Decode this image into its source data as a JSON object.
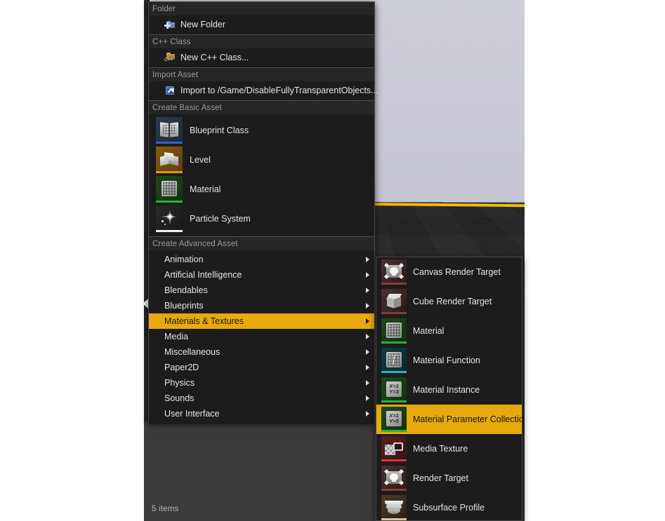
{
  "viewport": {
    "name": "level-viewport",
    "sky_color": "#c9cad5",
    "ground_color": "#2d2d2d",
    "horizon_color": "#f4b30a"
  },
  "content_browser": {
    "item_count_label": "5 items",
    "collapse_arrow_icon": "chevron-left-icon"
  },
  "context_menu": {
    "sections": [
      {
        "id": "folder",
        "header": "Folder",
        "type": "small",
        "items": [
          {
            "label": "New Folder",
            "icon": "new-folder-icon"
          }
        ]
      },
      {
        "id": "cpp-class",
        "header": "C++ Class",
        "type": "small",
        "items": [
          {
            "label": "New C++ Class...",
            "icon": "cpp-class-icon"
          }
        ]
      },
      {
        "id": "import-asset",
        "header": "Import Asset",
        "type": "small",
        "items": [
          {
            "label": "Import to /Game/DisableFullyTransparentObjects...",
            "icon": "import-icon"
          }
        ]
      },
      {
        "id": "create-basic-asset",
        "header": "Create Basic Asset",
        "type": "big",
        "items": [
          {
            "label": "Blueprint Class",
            "icon": "blueprint-class-icon",
            "stripe": "#2f62c4"
          },
          {
            "label": "Level",
            "icon": "level-icon",
            "stripe": "#e8950c"
          },
          {
            "label": "Material",
            "icon": "material-icon",
            "stripe": "#2fae38"
          },
          {
            "label": "Particle System",
            "icon": "particle-system-icon",
            "stripe": "#f2f2f2"
          }
        ]
      },
      {
        "id": "create-advanced-asset",
        "header": "Create Advanced Asset",
        "type": "submenu",
        "items": [
          {
            "label": "Animation",
            "selected": false
          },
          {
            "label": "Artificial Intelligence",
            "selected": false
          },
          {
            "label": "Blendables",
            "selected": false
          },
          {
            "label": "Blueprints",
            "selected": false
          },
          {
            "label": "Materials & Textures",
            "selected": true
          },
          {
            "label": "Media",
            "selected": false
          },
          {
            "label": "Miscellaneous",
            "selected": false
          },
          {
            "label": "Paper2D",
            "selected": false
          },
          {
            "label": "Physics",
            "selected": false
          },
          {
            "label": "Sounds",
            "selected": false
          },
          {
            "label": "User Interface",
            "selected": false
          }
        ]
      }
    ]
  },
  "submenu": {
    "parent": "Materials & Textures",
    "items": [
      {
        "label": "Canvas Render Target",
        "icon": "canvas-render-target-icon",
        "stripe": "#8c3a3a",
        "selected": false
      },
      {
        "label": "Cube Render Target",
        "icon": "cube-render-target-icon",
        "stripe": "#8c3a3a",
        "selected": false
      },
      {
        "label": "Material",
        "icon": "material-icon",
        "stripe": "#2fae38",
        "selected": false
      },
      {
        "label": "Material Function",
        "icon": "material-function-icon",
        "stripe": "#17b9c6",
        "selected": false
      },
      {
        "label": "Material Instance",
        "icon": "material-instance-icon",
        "stripe": "#2fae38",
        "selected": false
      },
      {
        "label": "Material Parameter Collection",
        "icon": "material-parameter-collection-icon",
        "stripe": "#2fae38",
        "selected": true
      },
      {
        "label": "Media Texture",
        "icon": "media-texture-icon",
        "stripe": "#e03030",
        "selected": false
      },
      {
        "label": "Render Target",
        "icon": "render-target-icon",
        "stripe": "#8c3a3a",
        "selected": false
      },
      {
        "label": "Subsurface Profile",
        "icon": "subsurface-profile-icon",
        "stripe": "#e8c08a",
        "selected": false
      }
    ]
  },
  "icon_text": {
    "cpp": "C++",
    "mf": "f",
    "mi_x": "X=1",
    "mi_y": "Y=3",
    "mpc_x": "X=1",
    "mpc_y": "Y=5"
  },
  "colors": {
    "highlight": "#e7a90c",
    "menu_bg": "#1c1c1c",
    "header_bg": "#262626",
    "text": "#e3e3e3",
    "header_text": "#9a9a9a"
  }
}
